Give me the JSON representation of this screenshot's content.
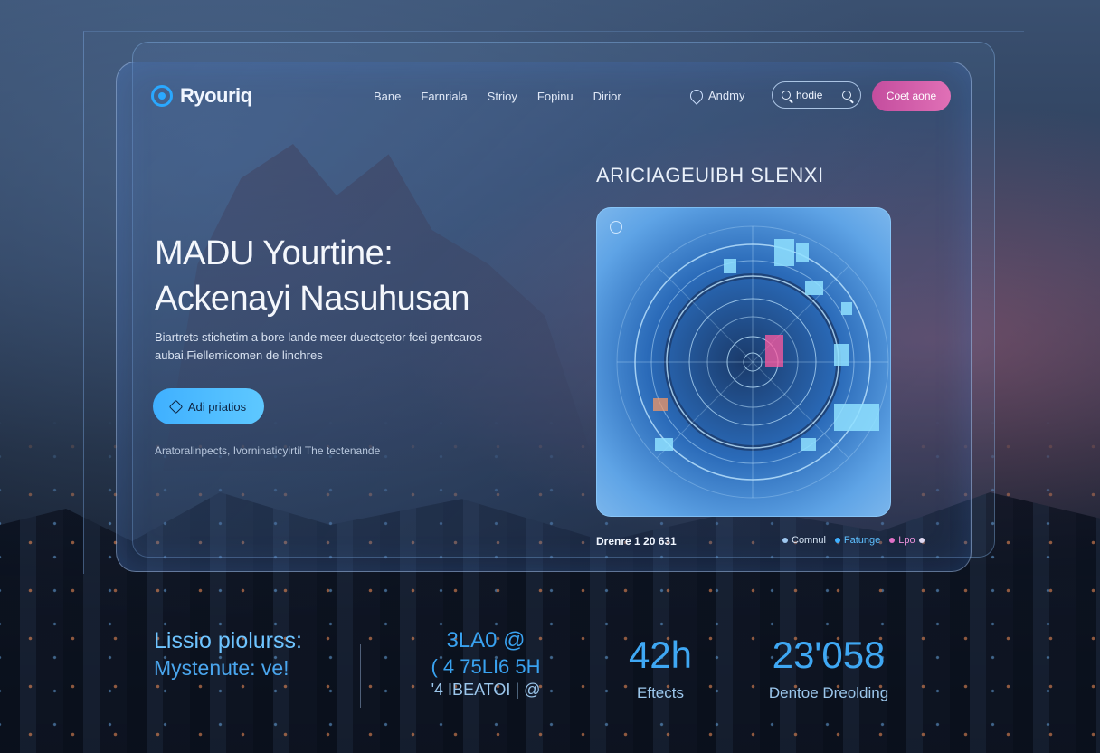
{
  "brand": {
    "name": "Ryouriq"
  },
  "nav": {
    "items": [
      "Bane",
      "Farnriala",
      "Strioy",
      "Fopinu",
      "Dirior"
    ]
  },
  "account": {
    "label": "Andmy"
  },
  "search": {
    "placeholder": "hodie"
  },
  "header_cta": {
    "label": "Coet aone"
  },
  "hero": {
    "title_line1": "MADU Yourtine:",
    "title_line2": "Ackenayi Nasuhusan",
    "description": "Biartrets stichetim a bore lande meer duectgetor fcei gentcaros aubai,Fiellemicomen de linchres",
    "button_label": "Adi priatios",
    "note": "Aratoralinpects, Ivorninaticyirtil The tectenande"
  },
  "section": {
    "title": "ARICIAGEUIBH SLENXI",
    "footer_label": "Drenre 1 20 631",
    "legend": [
      {
        "label": "Comnul",
        "color": "#9fc8f0"
      },
      {
        "label": "Fatunge",
        "color": "#3fb0ff"
      },
      {
        "label": "Lpo",
        "color": "#e070c6"
      }
    ]
  },
  "stats": {
    "text_line1": "Lissio piolurss:",
    "text_line2": "Mystenute: ve!",
    "stat1_line1": "3LA0 @",
    "stat1_line2": "( 4 75LI6 5H",
    "stat1_line3": "'4 IBEATOI | @",
    "stat2_value": "42h",
    "stat2_label": "Eftects",
    "stat3_value": "23'058",
    "stat3_label": "Dentoe Dreolding"
  },
  "colors": {
    "accent": "#3fb0ff",
    "cta": "#d45aa8"
  }
}
